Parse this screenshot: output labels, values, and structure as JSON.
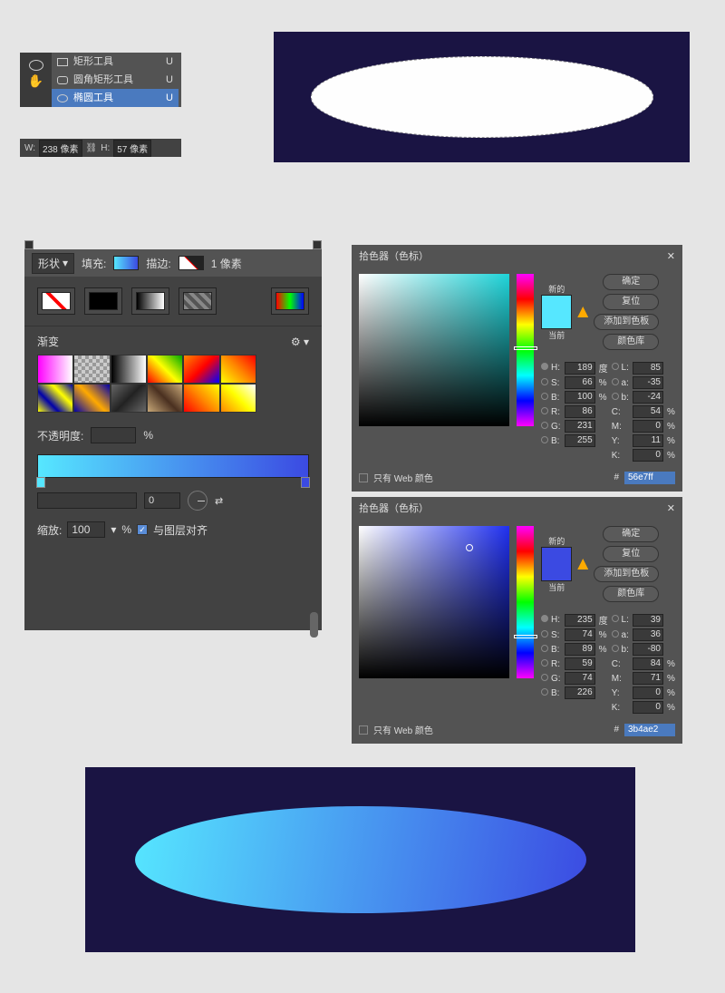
{
  "tools": {
    "rect": "矩形工具",
    "rrect": "圆角矩形工具",
    "ellipse": "椭圆工具",
    "key": "U"
  },
  "wh": {
    "w_label": "W:",
    "w": "238 像素",
    "h_label": "H:",
    "h": "57 像素"
  },
  "sp": {
    "shape": "形状",
    "fill": "填充:",
    "stroke": "描边:",
    "stroke_w": "1 像素",
    "grad_title": "渐变",
    "opacity": "不透明度:",
    "pct": "%",
    "angle_zero": "0",
    "scale": "缩放:",
    "scale_v": "100",
    "align": "与图层对齐"
  },
  "picker_title": "拾色器（色标）",
  "pk": {
    "ok": "确定",
    "reset": "复位",
    "add": "添加到色板",
    "lib": "颜色库",
    "new": "新的",
    "cur": "当前",
    "web": "只有 Web 颜色",
    "H": "H:",
    "S": "S:",
    "B": "B:",
    "R": "R:",
    "G": "G:",
    "Bb": "B:",
    "L": "L:",
    "a": "a:",
    "b": "b:",
    "C": "C:",
    "M": "M:",
    "Y": "Y:",
    "K": "K:",
    "deg": "度",
    "pct": "%",
    "hash": "#"
  },
  "c1": {
    "H": "189",
    "S": "66",
    "B": "100",
    "R": "86",
    "G": "231",
    "Bb": "255",
    "L": "85",
    "a": "-35",
    "bb": "-24",
    "C": "54",
    "M": "0",
    "Y": "11",
    "K": "0",
    "hex": "56e7ff",
    "sw": "#56e7ff"
  },
  "c2": {
    "H": "235",
    "S": "74",
    "B": "89",
    "R": "59",
    "G": "74",
    "Bb": "226",
    "L": "39",
    "a": "36",
    "bb": "-80",
    "C": "84",
    "M": "71",
    "Y": "0",
    "K": "0",
    "hex": "3b4ae2",
    "sw": "#3b4ae2"
  }
}
